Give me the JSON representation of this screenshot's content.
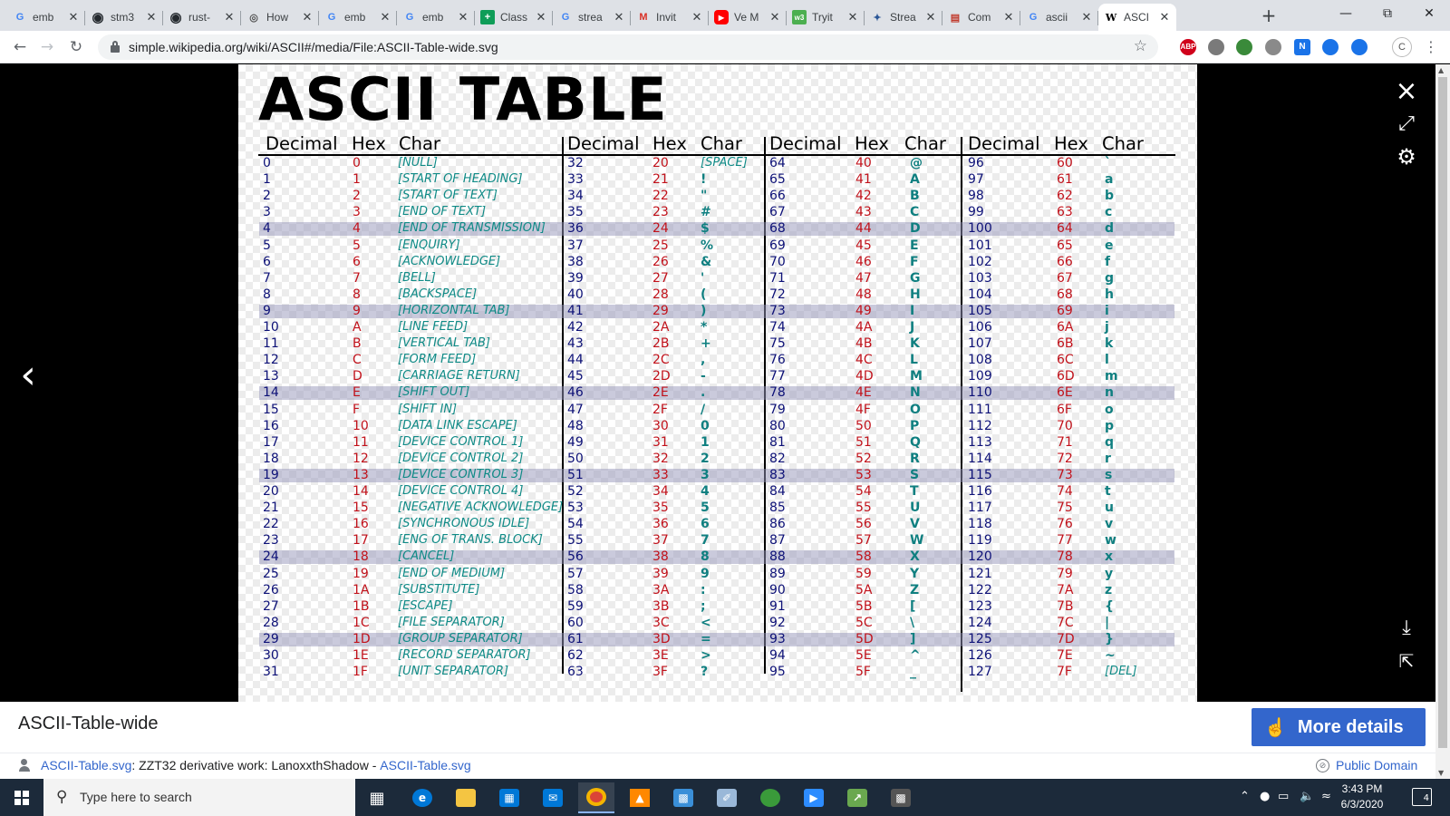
{
  "browser": {
    "tabs": [
      {
        "title": "emb",
        "icon": "google-icon",
        "color": "#4285f4"
      },
      {
        "title": "stm3",
        "icon": "github-icon",
        "color": "#24292e"
      },
      {
        "title": "rust-",
        "icon": "github-icon",
        "color": "#24292e"
      },
      {
        "title": "How",
        "icon": "globe-icon",
        "color": "#555555"
      },
      {
        "title": "emb",
        "icon": "google-icon",
        "color": "#4285f4"
      },
      {
        "title": "emb",
        "icon": "google-icon",
        "color": "#4285f4"
      },
      {
        "title": "Class",
        "icon": "classroom-icon",
        "color": "#0f9d58"
      },
      {
        "title": "strea",
        "icon": "google-icon",
        "color": "#4285f4"
      },
      {
        "title": "Invit",
        "icon": "gmail-icon",
        "color": "#d93025"
      },
      {
        "title": "Ve M",
        "icon": "youtube-icon",
        "color": "#ff0000"
      },
      {
        "title": "Tryit",
        "icon": "w3schools-icon",
        "color": "#4caf50"
      },
      {
        "title": "Strea",
        "icon": "bird-icon",
        "color": "#2b5797"
      },
      {
        "title": "Com",
        "icon": "document-icon",
        "color": "#c0392b"
      },
      {
        "title": "ascii",
        "icon": "google-icon",
        "color": "#4285f4"
      },
      {
        "title": "ASCI",
        "icon": "wikipedia-icon",
        "color": "#000000",
        "active": true
      }
    ],
    "url": "simple.wikipedia.org/wiki/ASCII#/media/File:ASCII-Table-wide.svg",
    "profile_initial": "C",
    "extensions": [
      {
        "label": "ABP",
        "color": "#d0021b"
      },
      {
        "label": "",
        "color": "#7a7a7a"
      },
      {
        "label": "",
        "color": "#3a8a3a"
      },
      {
        "label": "",
        "color": "#8a8a8a"
      },
      {
        "label": "N",
        "color": "#1a73e8"
      },
      {
        "label": "",
        "color": "#1a73e8"
      },
      {
        "label": "",
        "color": "#1a73e8"
      }
    ]
  },
  "image": {
    "title": "ASCII TABLE",
    "headers": {
      "decimal": "Decimal",
      "hex": "Hex",
      "char": "Char"
    },
    "rows": [
      [
        "0",
        "0",
        "[NULL]",
        "32",
        "20",
        "[SPACE]",
        "64",
        "40",
        "@",
        "96",
        "60",
        "`"
      ],
      [
        "1",
        "1",
        "[START OF HEADING]",
        "33",
        "21",
        "!",
        "65",
        "41",
        "A",
        "97",
        "61",
        "a"
      ],
      [
        "2",
        "2",
        "[START OF TEXT]",
        "34",
        "22",
        "\"",
        "66",
        "42",
        "B",
        "98",
        "62",
        "b"
      ],
      [
        "3",
        "3",
        "[END OF TEXT]",
        "35",
        "23",
        "#",
        "67",
        "43",
        "C",
        "99",
        "63",
        "c"
      ],
      [
        "4",
        "4",
        "[END OF TRANSMISSION]",
        "36",
        "24",
        "$",
        "68",
        "44",
        "D",
        "100",
        "64",
        "d"
      ],
      [
        "5",
        "5",
        "[ENQUIRY]",
        "37",
        "25",
        "%",
        "69",
        "45",
        "E",
        "101",
        "65",
        "e"
      ],
      [
        "6",
        "6",
        "[ACKNOWLEDGE]",
        "38",
        "26",
        "&",
        "70",
        "46",
        "F",
        "102",
        "66",
        "f"
      ],
      [
        "7",
        "7",
        "[BELL]",
        "39",
        "27",
        "'",
        "71",
        "47",
        "G",
        "103",
        "67",
        "g"
      ],
      [
        "8",
        "8",
        "[BACKSPACE]",
        "40",
        "28",
        "(",
        "72",
        "48",
        "H",
        "104",
        "68",
        "h"
      ],
      [
        "9",
        "9",
        "[HORIZONTAL TAB]",
        "41",
        "29",
        ")",
        "73",
        "49",
        "I",
        "105",
        "69",
        "i"
      ],
      [
        "10",
        "A",
        "[LINE FEED]",
        "42",
        "2A",
        "*",
        "74",
        "4A",
        "J",
        "106",
        "6A",
        "j"
      ],
      [
        "11",
        "B",
        "[VERTICAL TAB]",
        "43",
        "2B",
        "+",
        "75",
        "4B",
        "K",
        "107",
        "6B",
        "k"
      ],
      [
        "12",
        "C",
        "[FORM FEED]",
        "44",
        "2C",
        ",",
        "76",
        "4C",
        "L",
        "108",
        "6C",
        "l"
      ],
      [
        "13",
        "D",
        "[CARRIAGE RETURN]",
        "45",
        "2D",
        "-",
        "77",
        "4D",
        "M",
        "109",
        "6D",
        "m"
      ],
      [
        "14",
        "E",
        "[SHIFT OUT]",
        "46",
        "2E",
        ".",
        "78",
        "4E",
        "N",
        "110",
        "6E",
        "n"
      ],
      [
        "15",
        "F",
        "[SHIFT IN]",
        "47",
        "2F",
        "/",
        "79",
        "4F",
        "O",
        "111",
        "6F",
        "o"
      ],
      [
        "16",
        "10",
        "[DATA LINK ESCAPE]",
        "48",
        "30",
        "0",
        "80",
        "50",
        "P",
        "112",
        "70",
        "p"
      ],
      [
        "17",
        "11",
        "[DEVICE CONTROL 1]",
        "49",
        "31",
        "1",
        "81",
        "51",
        "Q",
        "113",
        "71",
        "q"
      ],
      [
        "18",
        "12",
        "[DEVICE CONTROL 2]",
        "50",
        "32",
        "2",
        "82",
        "52",
        "R",
        "114",
        "72",
        "r"
      ],
      [
        "19",
        "13",
        "[DEVICE CONTROL 3]",
        "51",
        "33",
        "3",
        "83",
        "53",
        "S",
        "115",
        "73",
        "s"
      ],
      [
        "20",
        "14",
        "[DEVICE CONTROL 4]",
        "52",
        "34",
        "4",
        "84",
        "54",
        "T",
        "116",
        "74",
        "t"
      ],
      [
        "21",
        "15",
        "[NEGATIVE ACKNOWLEDGE]",
        "53",
        "35",
        "5",
        "85",
        "55",
        "U",
        "117",
        "75",
        "u"
      ],
      [
        "22",
        "16",
        "[SYNCHRONOUS IDLE]",
        "54",
        "36",
        "6",
        "86",
        "56",
        "V",
        "118",
        "76",
        "v"
      ],
      [
        "23",
        "17",
        "[ENG OF TRANS. BLOCK]",
        "55",
        "37",
        "7",
        "87",
        "57",
        "W",
        "119",
        "77",
        "w"
      ],
      [
        "24",
        "18",
        "[CANCEL]",
        "56",
        "38",
        "8",
        "88",
        "58",
        "X",
        "120",
        "78",
        "x"
      ],
      [
        "25",
        "19",
        "[END OF MEDIUM]",
        "57",
        "39",
        "9",
        "89",
        "59",
        "Y",
        "121",
        "79",
        "y"
      ],
      [
        "26",
        "1A",
        "[SUBSTITUTE]",
        "58",
        "3A",
        ":",
        "90",
        "5A",
        "Z",
        "122",
        "7A",
        "z"
      ],
      [
        "27",
        "1B",
        "[ESCAPE]",
        "59",
        "3B",
        ";",
        "91",
        "5B",
        "[",
        "123",
        "7B",
        "{"
      ],
      [
        "28",
        "1C",
        "[FILE SEPARATOR]",
        "60",
        "3C",
        "<",
        "92",
        "5C",
        "\\",
        "124",
        "7C",
        "|"
      ],
      [
        "29",
        "1D",
        "[GROUP SEPARATOR]",
        "61",
        "3D",
        "=",
        "93",
        "5D",
        "]",
        "125",
        "7D",
        "}"
      ],
      [
        "30",
        "1E",
        "[RECORD SEPARATOR]",
        "62",
        "3E",
        ">",
        "94",
        "5E",
        "^",
        "126",
        "7E",
        "~"
      ],
      [
        "31",
        "1F",
        "[UNIT SEPARATOR]",
        "63",
        "3F",
        "?",
        "95",
        "5F",
        "_",
        "127",
        "7F",
        "[DEL]"
      ]
    ],
    "colors": {
      "decimal": "#0d1177",
      "hex": "#c1111a",
      "char": "#0f8a86",
      "band": "#9696b9"
    }
  },
  "viewer": {
    "close_icon": "×",
    "expand_icon": "⤢",
    "settings_icon": "⚙",
    "prev_icon": "‹",
    "download_icon": "⤓",
    "share_icon": "⇱"
  },
  "caption": {
    "title": "ASCII-Table-wide",
    "more_details": "More details",
    "credit_link1": "ASCII-Table.svg",
    "credit_text": ": ZZT32 derivative work: LanoxxthShadow - ",
    "credit_link2": "ASCII-Table.svg",
    "license": "Public Domain"
  },
  "taskbar": {
    "search_placeholder": "Type here to search",
    "time": "3:43 PM",
    "date": "6/3/2020",
    "notifications": "4"
  }
}
